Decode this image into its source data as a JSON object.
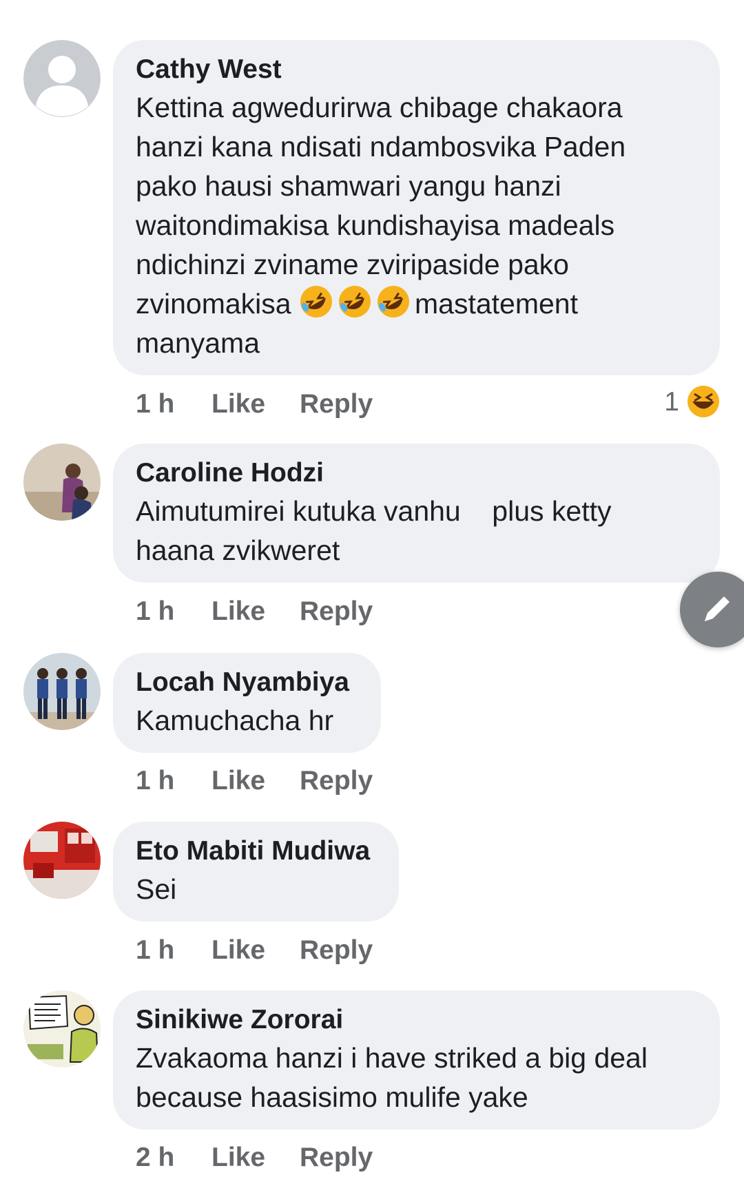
{
  "colors": {
    "bubble": "#eff0f3",
    "meta_text": "#65676b",
    "name_text": "#1c1e21",
    "fab": "#7d8084"
  },
  "comments": [
    {
      "author": "Cathy West",
      "avatar": "default-profile-icon",
      "text_lines": [
        "Kettina agwedurirwa chibage chakaora",
        "hanzi kana  ndisati ndambosvika Paden",
        "pako hausi shamwari yangu hanzi",
        "waitondimakisa kundishayisa madeals",
        "ndichinzi zviname zviripaside pako",
        "zvinomakisa ",
        "manyama"
      ],
      "inline_emoji": "rolling-on-floor-laughing-emoji",
      "inline_emoji_count": 3,
      "text_after_emoji": "mastatement",
      "time": "1 h",
      "like": "Like",
      "reply": "Reply",
      "reaction_count": "1",
      "reaction_emoji": "laughing-emoji"
    },
    {
      "author": "Caroline Hodzi",
      "avatar": "profile-photo",
      "text_lines": [
        "Aimutumirei kutuka vanhu    plus ketty",
        "haana zvikweret"
      ],
      "time": "1 h",
      "like": "Like",
      "reply": "Reply"
    },
    {
      "author": "Locah Nyambiya",
      "avatar": "profile-photo",
      "text_lines": [
        "Kamuchacha hr"
      ],
      "time": "1 h",
      "like": "Like",
      "reply": "Reply"
    },
    {
      "author": "Eto Mabiti Mudiwa",
      "avatar": "profile-photo",
      "text_lines": [
        "Sei"
      ],
      "time": "1 h",
      "like": "Like",
      "reply": "Reply"
    },
    {
      "author": "Sinikiwe Zororai",
      "avatar": "profile-photo",
      "text_lines": [
        "Zvakaoma hanzi i have striked a  big deal",
        "because haasisimo mulife yake"
      ],
      "time": "2 h",
      "like": "Like",
      "reply": "Reply"
    }
  ],
  "fab_icon": "pencil-icon"
}
